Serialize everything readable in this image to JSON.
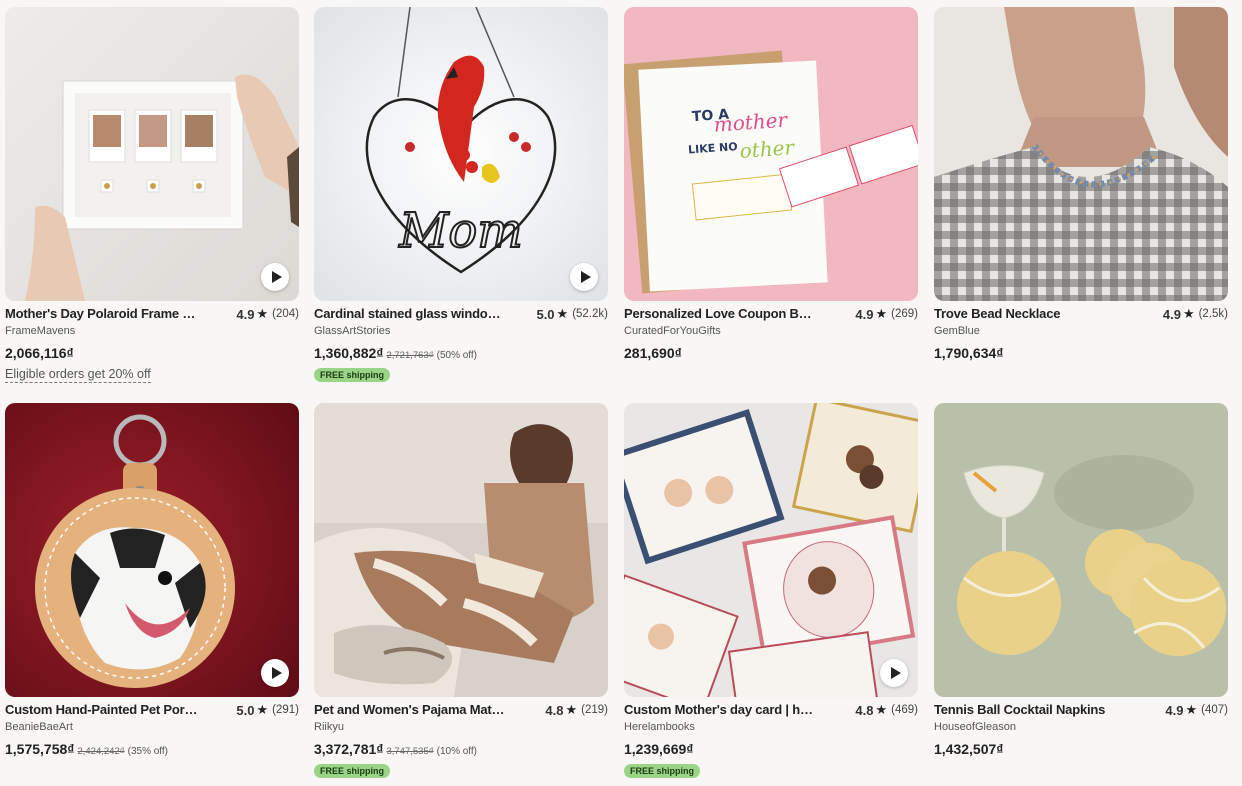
{
  "listings": [
    {
      "title": "Mother's Day Polaroid Frame wit...",
      "rating": "4.9",
      "reviews": "(204)",
      "shop": "FrameMavens",
      "price": "2,066,116₫",
      "promo": "Eligible orders get 20% off",
      "image": "polaroid-frame-image",
      "has_video": true
    },
    {
      "title": "Cardinal stained glass window ha...",
      "rating": "5.0",
      "reviews": "(52.2k)",
      "shop": "GlassArtStories",
      "price": "1,360,882₫",
      "original_price": "2,721,763₫",
      "discount": "(50% off)",
      "badge": "FREE shipping",
      "image": "cardinal-suncatcher-image",
      "has_video": true
    },
    {
      "title": "Personalized Love Coupon Book f...",
      "rating": "4.9",
      "reviews": "(269)",
      "shop": "CuratedForYouGifts",
      "price": "281,690₫",
      "image": "coupon-card-image",
      "has_video": false
    },
    {
      "title": "Trove Bead Necklace",
      "rating": "4.9",
      "reviews": "(2.5k)",
      "shop": "GemBlue",
      "price": "1,790,634₫",
      "image": "bead-necklace-image",
      "has_video": false
    },
    {
      "title": "Custom Hand-Painted Pet Portrai...",
      "rating": "5.0",
      "reviews": "(291)",
      "shop": "BeanieBaeArt",
      "price": "1,575,758₫",
      "original_price": "2,424,242₫",
      "discount": "(35% off)",
      "image": "pet-keychain-image",
      "has_video": true
    },
    {
      "title": "Pet and Women's Pajama Match ...",
      "rating": "4.8",
      "reviews": "(219)",
      "shop": "Riikyu",
      "price": "3,372,781₫",
      "original_price": "3,747,535₫",
      "discount": "(10% off)",
      "badge": "FREE shipping",
      "image": "pajama-image",
      "has_video": false
    },
    {
      "title": "Custom Mother's day card | hand ...",
      "rating": "4.8",
      "reviews": "(469)",
      "shop": "Herelambooks",
      "price": "1,239,669₫",
      "badge": "FREE shipping",
      "image": "mothers-day-cards-image",
      "has_video": true
    },
    {
      "title": "Tennis Ball Cocktail Napkins",
      "rating": "4.9",
      "reviews": "(407)",
      "shop": "HouseofGleason",
      "price": "1,432,507₫",
      "image": "tennis-napkins-image",
      "has_video": false
    }
  ],
  "image_text": {
    "suncatcher_word": "Mom",
    "card_line1": "TO A",
    "card_line2": "mother",
    "card_line3": "LIKE NO",
    "card_line4": "other"
  },
  "colors": {
    "badge_green": "#9ad486",
    "accent_text": "#222222",
    "background": "#f8f7f5"
  }
}
